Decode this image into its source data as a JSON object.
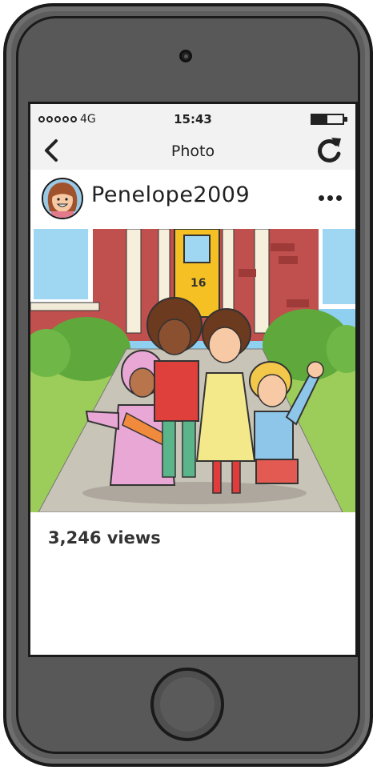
{
  "status_bar": {
    "signal_dots": 5,
    "network": "4G",
    "time": "15:43",
    "battery_level": 0.5,
    "battery_icon": "battery-icon"
  },
  "nav": {
    "title": "Photo",
    "back_icon": "chevron-left-icon",
    "refresh_icon": "refresh-icon"
  },
  "post": {
    "username": "Penelope2009",
    "avatar_icon": "avatar",
    "more_icon": "more-horizontal-icon",
    "photo_description": "children-group-photo",
    "views": "3,246 views"
  },
  "colors": {
    "phone_body": "#5d5d5d",
    "screen_bg": "#ffffff",
    "bar_bg": "#f2f2f2",
    "text": "#222222"
  }
}
